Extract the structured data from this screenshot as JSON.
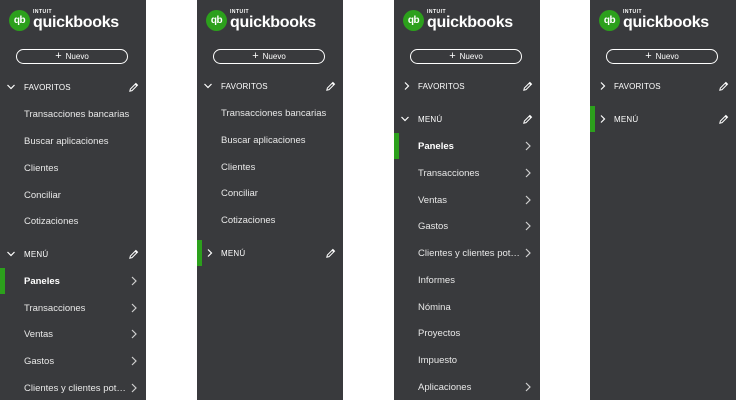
{
  "brand": {
    "intuit": "INTUIT",
    "name": "quickbooks",
    "badge": "qb"
  },
  "new_button": {
    "plus": "+",
    "label": "Nuevo"
  },
  "sections": {
    "favorites": "FAVORITOS",
    "menu": "MENÚ"
  },
  "favorites_items": [
    "Transacciones bancarias",
    "Buscar aplicaciones",
    "Clientes",
    "Conciliar",
    "Cotizaciones"
  ],
  "menu_items": [
    "Paneles",
    "Transacciones",
    "Ventas",
    "Gastos",
    "Clientes y clientes pot…",
    "Informes",
    "Nómina",
    "Proyectos",
    "Impuesto",
    "Aplicaciones"
  ],
  "colors": {
    "panel": "#393a3d",
    "accent": "#2ca01c",
    "text": "#ffffff"
  }
}
